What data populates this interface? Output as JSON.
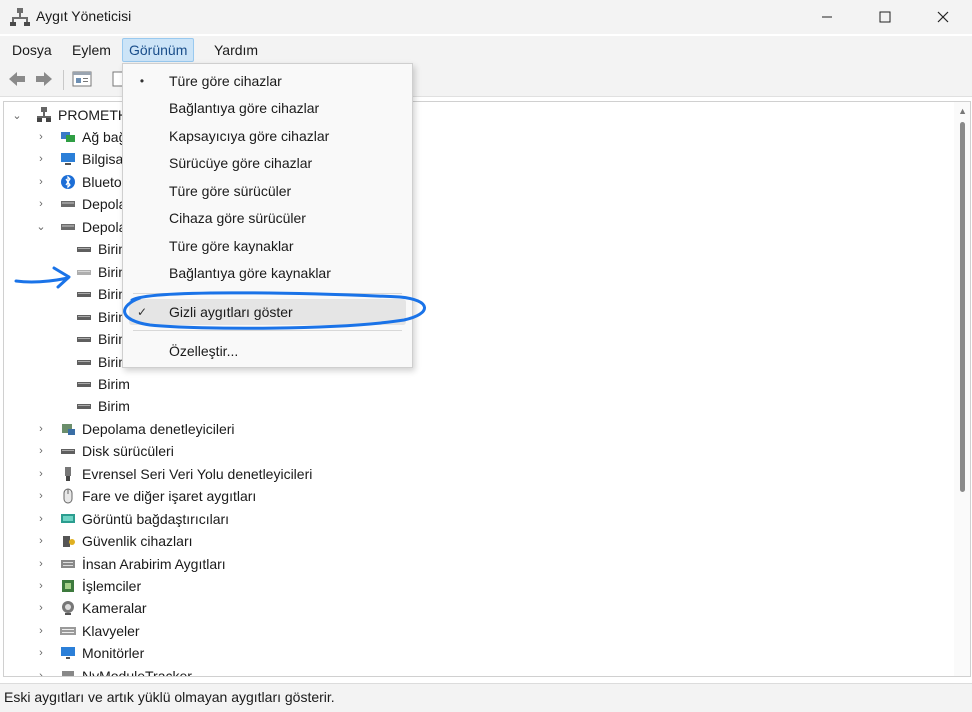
{
  "window": {
    "title": "Aygıt Yöneticisi",
    "icons": {
      "app": "device-manager-icon",
      "minimize": "minimize-icon",
      "maximize": "maximize-icon",
      "close": "close-icon"
    }
  },
  "menubar": {
    "items": [
      {
        "label": "Dosya"
      },
      {
        "label": "Eylem"
      },
      {
        "label": "Görünüm",
        "active": true
      },
      {
        "label": "Yardım"
      }
    ]
  },
  "toolbar": {
    "icons": [
      "back-arrow-icon",
      "forward-arrow-icon",
      "properties-icon",
      "help-icon"
    ]
  },
  "view_menu": {
    "items": [
      {
        "label": "Türe göre cihazlar",
        "mark": "•"
      },
      {
        "label": "Bağlantıya göre cihazlar",
        "mark": ""
      },
      {
        "label": "Kapsayıcıya göre cihazlar",
        "mark": ""
      },
      {
        "label": "Sürücüye göre cihazlar",
        "mark": ""
      },
      {
        "label": "Türe göre sürücüler",
        "mark": ""
      },
      {
        "label": "Cihaza göre sürücüler",
        "mark": ""
      },
      {
        "label": "Türe göre kaynaklar",
        "mark": ""
      },
      {
        "label": "Bağlantıya göre kaynaklar",
        "mark": ""
      },
      {
        "label": "Gizli aygıtları göster",
        "mark": "✓",
        "highlighted": true
      },
      {
        "label": "Özelleştir...",
        "mark": ""
      }
    ]
  },
  "tree": {
    "root": "PROMETH",
    "nodes": [
      {
        "label": "Ağ bağ",
        "expander": "›",
        "icon": "network-icon"
      },
      {
        "label": "Bilgisa",
        "expander": "›",
        "icon": "computer-icon"
      },
      {
        "label": "Blueto",
        "expander": "›",
        "icon": "bluetooth-icon"
      },
      {
        "label": "Depola",
        "expander": "›",
        "icon": "drive-icon"
      },
      {
        "label": "Depola",
        "expander": "⌄",
        "icon": "drive-icon"
      },
      {
        "label": "Birim",
        "child": true,
        "icon": "volume-icon"
      },
      {
        "label": "Birim",
        "child": true,
        "icon": "volume-icon",
        "dim": true
      },
      {
        "label": "Birim",
        "child": true,
        "icon": "volume-icon"
      },
      {
        "label": "Birim",
        "child": true,
        "icon": "volume-icon"
      },
      {
        "label": "Birim",
        "child": true,
        "icon": "volume-icon"
      },
      {
        "label": "Birim",
        "child": true,
        "icon": "volume-icon"
      },
      {
        "label": "Birim",
        "child": true,
        "icon": "volume-icon"
      },
      {
        "label": "Birim",
        "child": true,
        "icon": "volume-icon"
      },
      {
        "label": "Depolama denetleyicileri",
        "expander": "›",
        "icon": "storage-controller-icon"
      },
      {
        "label": "Disk sürücüleri",
        "expander": "›",
        "icon": "disk-icon"
      },
      {
        "label": "Evrensel Seri Veri Yolu denetleyicileri",
        "expander": "›",
        "icon": "usb-icon"
      },
      {
        "label": "Fare ve diğer işaret aygıtları",
        "expander": "›",
        "icon": "mouse-icon"
      },
      {
        "label": "Görüntü bağdaştırıcıları",
        "expander": "›",
        "icon": "display-adapter-icon"
      },
      {
        "label": "Güvenlik cihazları",
        "expander": "›",
        "icon": "security-device-icon"
      },
      {
        "label": "İnsan Arabirim Aygıtları",
        "expander": "›",
        "icon": "hid-icon"
      },
      {
        "label": "İşlemciler",
        "expander": "›",
        "icon": "processor-icon"
      },
      {
        "label": "Kameralar",
        "expander": "›",
        "icon": "camera-icon"
      },
      {
        "label": "Klavyeler",
        "expander": "›",
        "icon": "keyboard-icon"
      },
      {
        "label": "Monitörler",
        "expander": "›",
        "icon": "monitor-icon"
      },
      {
        "label": "NvModuleTracker",
        "expander": "›",
        "icon": "module-icon"
      }
    ]
  },
  "statusbar": {
    "text": "Eski aygıtları ve artık yüklü olmayan aygıtları gösterir."
  },
  "colors": {
    "menu_active_bg": "#cce4f7",
    "annotation_blue": "#1a73e8",
    "chrome_bg": "#f3f3f3"
  }
}
